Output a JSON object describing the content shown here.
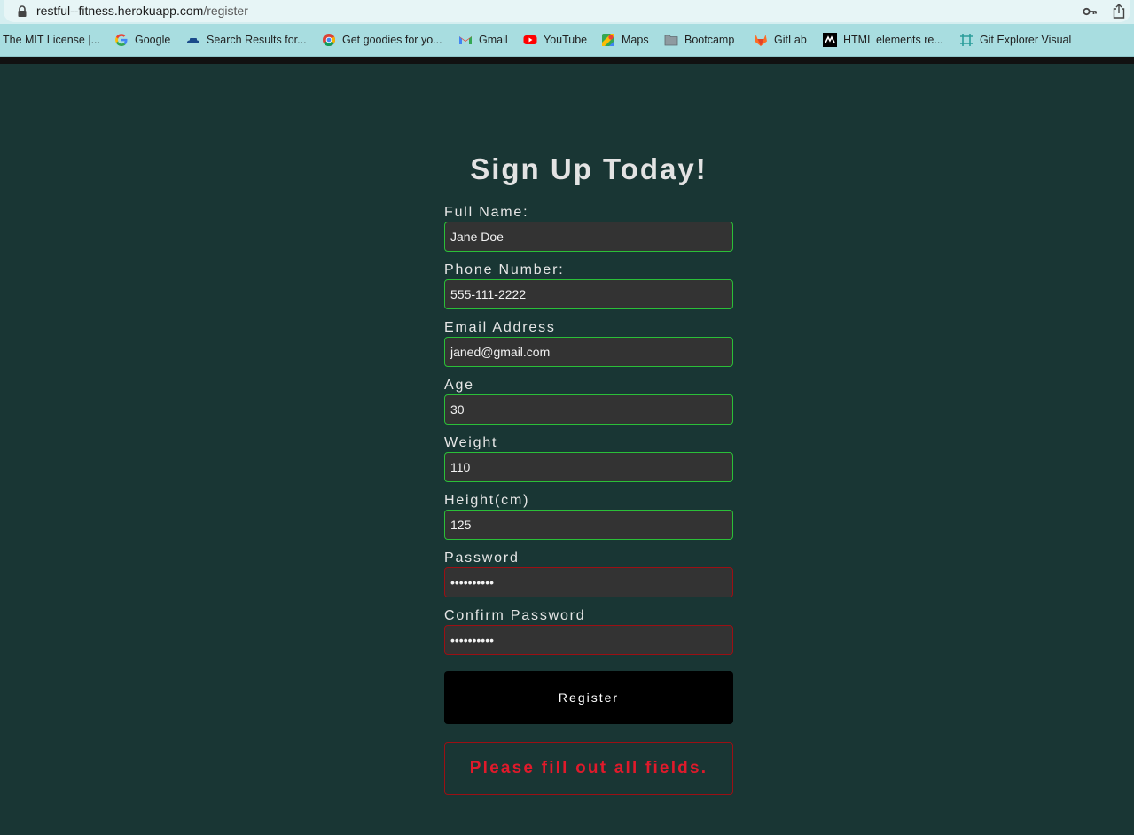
{
  "browser": {
    "url_host": "restful--fitness.herokuapp.com",
    "url_path": "/register",
    "bookmarks": [
      {
        "label": "The MIT License |...",
        "icon": "none"
      },
      {
        "label": "Google",
        "icon": "google-icon"
      },
      {
        "label": "Search Results for...",
        "icon": "hat-icon"
      },
      {
        "label": "Get goodies for yo...",
        "icon": "chrome-icon"
      },
      {
        "label": "Gmail",
        "icon": "gmail-icon"
      },
      {
        "label": "YouTube",
        "icon": "youtube-icon"
      },
      {
        "label": "Maps",
        "icon": "maps-icon"
      },
      {
        "label": "Bootcamp",
        "icon": "folder-icon"
      },
      {
        "label": "GitLab",
        "icon": "gitlab-icon"
      },
      {
        "label": "HTML elements re...",
        "icon": "mdn-icon"
      },
      {
        "label": "Git Explorer Visual",
        "icon": "git-explorer-icon"
      }
    ]
  },
  "form": {
    "title": "Sign Up Today!",
    "fields": [
      {
        "label": "Full Name:",
        "value": "Jane Doe"
      },
      {
        "label": "Phone Number:",
        "value": "555-111-2222"
      },
      {
        "label": "Email Address",
        "value": "janed@gmail.com"
      },
      {
        "label": "Age",
        "value": "30"
      },
      {
        "label": "Weight",
        "value": "110"
      },
      {
        "label": "Height(cm)",
        "value": "125"
      },
      {
        "label": "Password",
        "value": "••••••••••"
      },
      {
        "label": "Confirm Password",
        "value": "••••••••••"
      }
    ],
    "register_label": "Register",
    "error_message": "Please fill out all fields."
  },
  "colors": {
    "page_bg": "#193634",
    "field_bg": "#333333",
    "valid_border": "#2bbf38",
    "invalid_border": "#9b1014",
    "error_text": "#e01a2b"
  }
}
